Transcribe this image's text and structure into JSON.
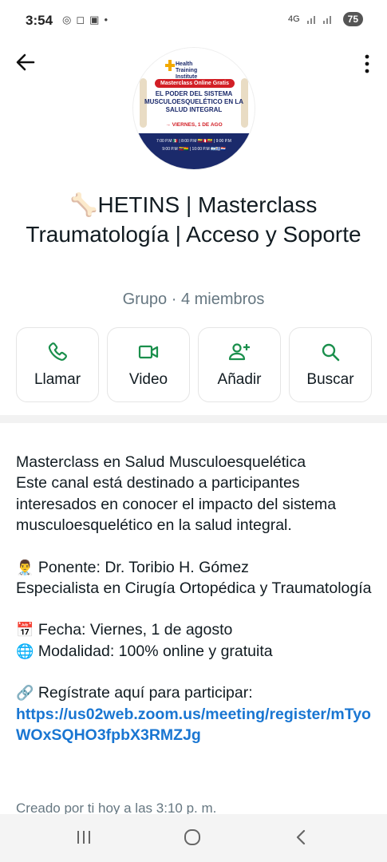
{
  "status_bar": {
    "time": "3:54",
    "network": "4G",
    "battery": "75"
  },
  "group": {
    "name": "🦴HETINS | Masterclass Traumatología | Acceso y Soporte",
    "subtitle": "Grupo · 4 miembros"
  },
  "avatar_poster": {
    "logo_text": "Health Training Institute",
    "badge": "Masterclass Online Gratis",
    "title": "EL PODER DEL SISTEMA MUSCULOESQUELÉTICO EN LA SALUD INTEGRAL",
    "date": "→ VIERNES, 1 DE AGO",
    "times_row1": "7:00 P.M 🇲🇽 | 8:00 P.M 🇨🇴🇵🇪🇪🇨 | 9:00 P.M",
    "times_row2": "9:00 P.M 🇻🇪🇧🇴 | 10:00 P.M 🇦🇷🇺🇾🇵🇾"
  },
  "actions": [
    {
      "label": "Llamar",
      "icon": "phone-icon"
    },
    {
      "label": "Video",
      "icon": "video-icon"
    },
    {
      "label": "Añadir",
      "icon": "add-person-icon"
    },
    {
      "label": "Buscar",
      "icon": "search-icon"
    }
  ],
  "description": {
    "line1": "Masterclass en Salud Musculoesquelética",
    "line2": "Este canal está destinado a participantes interesados en conocer el impacto del sistema musculoesquelético en la salud integral.",
    "speaker_emoji": "👨‍⚕️",
    "speaker": " Ponente: Dr. Toribio H. Gómez",
    "specialty": "Especialista en Cirugía Ortopédica y Traumatología",
    "date_emoji": "📅",
    "date": " Fecha: Viernes, 1 de agosto",
    "mode_emoji": "🌐",
    "mode": " Modalidad: 100% online y gratuita",
    "register_emoji": "🔗",
    "register": " Regístrate aquí para participar:",
    "link": "https://us02web.zoom.us/meeting/register/mTyoWOxSQHO3fpbX3RMZJg"
  },
  "created": "Creado por ti hoy a las 3:10 p. m.",
  "colors": {
    "accent_green": "#1a8f4c",
    "link_blue": "#1976d2",
    "poster_navy": "#1b2a6b",
    "poster_red": "#d21f26"
  }
}
